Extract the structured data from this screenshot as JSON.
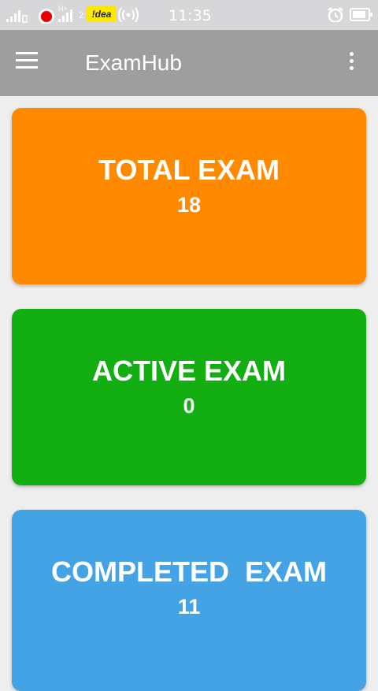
{
  "status_bar": {
    "time": "11:35",
    "carrier_badge": "!dea",
    "sim_label": "2",
    "network_label": "H+",
    "icons": [
      "signal-icon",
      "vodafone-icon",
      "signal-icon",
      "idea-icon",
      "hotspot-icon",
      "alarm-icon",
      "battery-icon"
    ]
  },
  "toolbar": {
    "title": "ExamHub",
    "menu_icon": "hamburger-menu-icon",
    "overflow_icon": "more-vert-icon"
  },
  "cards": {
    "total": {
      "label": "TOTAL EXAM",
      "count": "18",
      "color": "#ff8a00"
    },
    "active": {
      "label": "ACTIVE EXAM",
      "count": "0",
      "color": "#12ae12"
    },
    "completed": {
      "label": "COMPLETED  EXAM",
      "count": "11",
      "color": "#43a3e5"
    }
  }
}
